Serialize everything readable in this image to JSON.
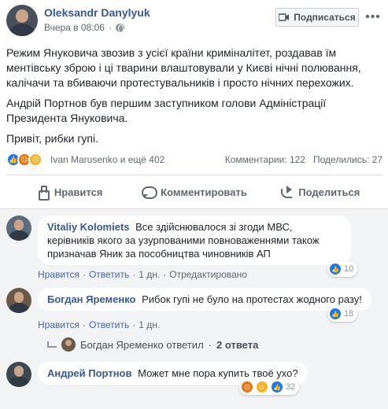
{
  "post": {
    "author": "Oleksandr Danylyuk",
    "time": "Вчера в 08:06",
    "subscribe_label": "Подписаться",
    "more_label": "•••",
    "paragraphs": [
      "Режим Януковича звозив з усієї країни криміналітет, роздавав їм ментівську зброю і ці тварини влаштовували у Києві нічні полювання, калічачи та вбиваючи протестувальників і просто нічних перехожих.",
      "Андрій Портнов був першим заступником голови Адміністрації Президента Януковича.",
      "Привіт, рибки гупі."
    ],
    "reaction_names": "Ivan Marusenko и ещё 402",
    "comments_count": "Комментарии: 122",
    "shares_count": "Поделились: 27",
    "actions": {
      "like": "Нравится",
      "comment": "Комментировать",
      "share": "Поделиться"
    }
  },
  "comments": [
    {
      "author": "Vitaliy Kolomiets",
      "text": "Все здійснювалося зі згоди МВС, керівників якого за узурпованими повноваженнями також призначав Яник за пособництва чиновників АП",
      "like": "Нравится",
      "reply": "Ответить",
      "time": "1 дн.",
      "edited": "Отредактировано",
      "reactions_count": "10"
    },
    {
      "author": "Богдан Яременко",
      "text": "Рибок гупі не було на протестах жодного разу!",
      "like": "Нравится",
      "reply": "Ответить",
      "time": "1 дн.",
      "reactions_count": "18"
    },
    {
      "author": "Андрей Портнов",
      "text": "Может мне пора купить твоё ухо?",
      "reactions_count": "32"
    }
  ],
  "replies": {
    "author": "Богдан Яременко ответил",
    "separator": "·",
    "count": "2 ответа"
  },
  "colors": {
    "link": "#385898",
    "like_blue": "#1877f2",
    "angry_orange": "#e9710f",
    "sad_yellow": "#f7b125"
  },
  "icons": [
    "globe-icon",
    "subscribe-icon",
    "like-icon",
    "comment-icon",
    "share-icon",
    "reply-arrow-icon"
  ]
}
